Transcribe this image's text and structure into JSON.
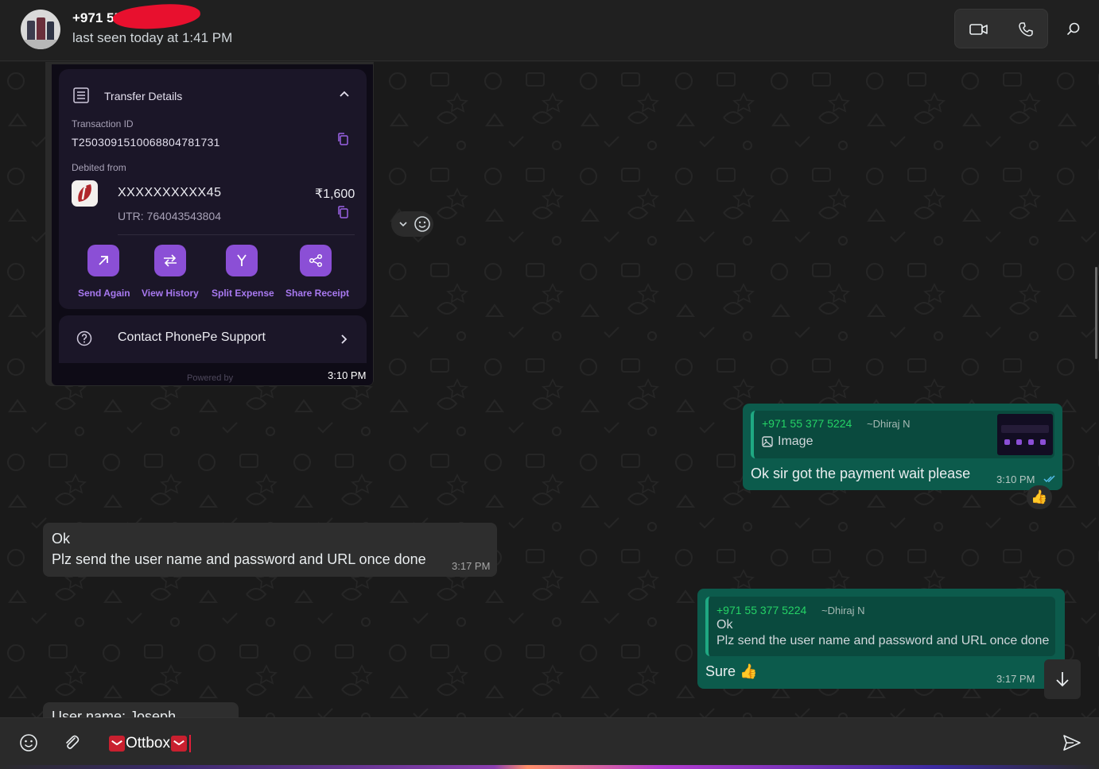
{
  "header": {
    "contact_name": "+971 55",
    "last_seen": "last seen today at 1:41 PM",
    "video_icon": "video-camera-icon",
    "call_icon": "phone-icon",
    "search_icon": "search-icon"
  },
  "screenshot": {
    "card_title": "Transfer Details",
    "transaction_id_label": "Transaction ID",
    "transaction_id": "T2503091510068804781731",
    "debited_from_label": "Debited from",
    "account": "XXXXXXXXXX45",
    "amount": "₹1,600",
    "utr": "UTR: 764043543804",
    "actions": [
      {
        "label": "Send Again"
      },
      {
        "label": "View History"
      },
      {
        "label": "Split Expense"
      },
      {
        "label": "Share Receipt"
      }
    ],
    "support": "Contact PhonePe Support",
    "powered_by": "Powered by",
    "time": "3:10 PM"
  },
  "messages": [
    {
      "quote_number": "+971 55 377 5224",
      "quote_author": "~Dhiraj N",
      "quote_text": "Image",
      "text": "Ok sir got the payment wait please",
      "time": "3:10 PM",
      "reaction": "👍"
    },
    {
      "line1": "Ok",
      "line2": "Plz send the user name and password and URL once done",
      "time": "3:17 PM"
    },
    {
      "quote_number": "+971 55 377 5224",
      "quote_author": "~Dhiraj N",
      "quote_line1": "Ok",
      "quote_line2": "Plz send the user name and password and URL once done",
      "text": "Sure 👍",
      "time": "3:17 PM"
    },
    {
      "text": "User name: Joseph"
    }
  ],
  "composer": {
    "draft": "Ottbox"
  },
  "colors": {
    "outgoing_bubble": "#0c5b4c",
    "incoming_bubble": "#2e2e2e",
    "accent_green": "#25d366",
    "phonepe_purple": "#8b4fd6"
  }
}
